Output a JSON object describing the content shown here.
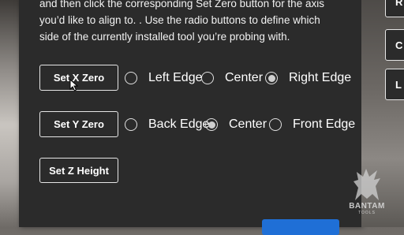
{
  "instructions": {
    "line1": "and then click the corresponding Set Zero button for the axis",
    "line2": "you’d like to align to. . Use the radio buttons to define which",
    "line3": "side of the currently installed tool you’re probing with."
  },
  "x_axis": {
    "button": "Set X Zero",
    "options": [
      "Left Edge",
      "Center",
      "Right Edge"
    ],
    "selected": "Right Edge"
  },
  "y_axis": {
    "button": "Set Y Zero",
    "options": [
      "Back Edge",
      "Center",
      "Front Edge"
    ],
    "selected": "Center"
  },
  "z_axis": {
    "button": "Set Z Height"
  },
  "side_buttons": [
    "R",
    "C",
    "L"
  ],
  "logo": {
    "name": "BANTAM",
    "sub": "TOOLS"
  },
  "colors": {
    "panel": "#2b2b2b",
    "primary": "#1f6fd6",
    "text": "#ffffff"
  }
}
